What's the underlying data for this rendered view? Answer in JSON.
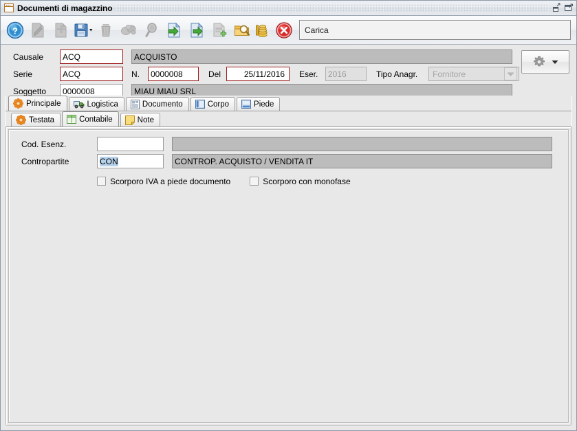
{
  "window": {
    "title": "Documenti di magazzino",
    "icon": "form-window-icon",
    "controls": [
      {
        "name": "restore-window-button",
        "icon": "restore-icon"
      },
      {
        "name": "maximize-window-button",
        "icon": "maximize-icon"
      }
    ]
  },
  "toolbar": {
    "buttons": [
      {
        "name": "help-button",
        "icon": "help-circle-icon",
        "enabled": true
      },
      {
        "name": "edit-document-button",
        "icon": "edit-document-icon",
        "enabled": false
      },
      {
        "name": "new-document-button",
        "icon": "new-document-icon",
        "enabled": false
      },
      {
        "name": "save-button",
        "icon": "save-floppy-icon",
        "enabled": true
      },
      {
        "name": "delete-button",
        "icon": "trash-icon",
        "enabled": false
      },
      {
        "name": "duplicate-button",
        "icon": "duplicate-icon",
        "enabled": false
      },
      {
        "name": "search-button",
        "icon": "magnifier-icon",
        "enabled": false
      },
      {
        "name": "import-document-button",
        "icon": "document-in-arrow-icon",
        "enabled": true
      },
      {
        "name": "export-document-button",
        "icon": "document-out-arrow-icon",
        "enabled": true
      },
      {
        "name": "add-row-button",
        "icon": "document-plus-icon",
        "enabled": false
      },
      {
        "name": "preview-button",
        "icon": "folder-magnifier-icon",
        "enabled": true
      },
      {
        "name": "payments-button",
        "icon": "coins-icon",
        "enabled": true
      },
      {
        "name": "close-button",
        "icon": "close-circle-icon",
        "enabled": true
      }
    ],
    "status_value": "Carica"
  },
  "header": {
    "causale_label": "Causale",
    "causale_value": "ACQ",
    "causale_desc": "ACQUISTO",
    "serie_label": "Serie",
    "serie_value": "ACQ",
    "numero_label": "N.",
    "numero_value": "0000008",
    "del_label": "Del",
    "del_value": "25/11/2016",
    "eser_label": "Eser.",
    "eser_value": "2016",
    "tipo_anagr_label": "Tipo Anagr.",
    "tipo_anagr_value": "Fornitore",
    "soggetto_label": "Soggetto",
    "soggetto_value": "0000008",
    "soggetto_desc": "MIAU MIAU SRL",
    "settings_button": {
      "name": "settings-button",
      "icon": "gear-icon",
      "dropdown": "chevron-down-icon"
    }
  },
  "tabs_primary": [
    {
      "label": "Principale",
      "icon": "orange-asterisk-icon",
      "active": true
    },
    {
      "label": "Logistica",
      "icon": "green-truck-icon",
      "active": false
    },
    {
      "label": "Documento",
      "icon": "document-lines-icon",
      "active": false
    },
    {
      "label": "Corpo",
      "icon": "panel-left-icon",
      "active": false
    },
    {
      "label": "Piede",
      "icon": "panel-bottom-icon",
      "active": false
    }
  ],
  "tabs_secondary": [
    {
      "label": "Testata",
      "icon": "orange-asterisk-icon",
      "active": false
    },
    {
      "label": "Contabile",
      "icon": "green-table-icon",
      "active": true
    },
    {
      "label": "Note",
      "icon": "yellow-note-icon",
      "active": false
    }
  ],
  "contabile": {
    "cod_esenz_label": "Cod. Esenz.",
    "cod_esenz_value": "",
    "cod_esenz_desc": "",
    "contropartite_label": "Contropartite",
    "contropartite_value": "CON",
    "contropartite_desc": "CONTROP. ACQUISTO / VENDITA IT",
    "checkbox_scorporo_iva": {
      "label": "Scorporo IVA a piede documento",
      "checked": false
    },
    "checkbox_scorporo_monofase": {
      "label": "Scorporo con monofase",
      "checked": false
    }
  },
  "colors": {
    "required_border": "#9e1b1b",
    "readonly_bg": "#bcbcbc",
    "window_bg": "#e8e8e8",
    "selection_bg": "#b6d2ea",
    "accent_orange": "#f08a20",
    "accent_green": "#4f9e2f",
    "desktop_bg": "#b4bcc6"
  }
}
